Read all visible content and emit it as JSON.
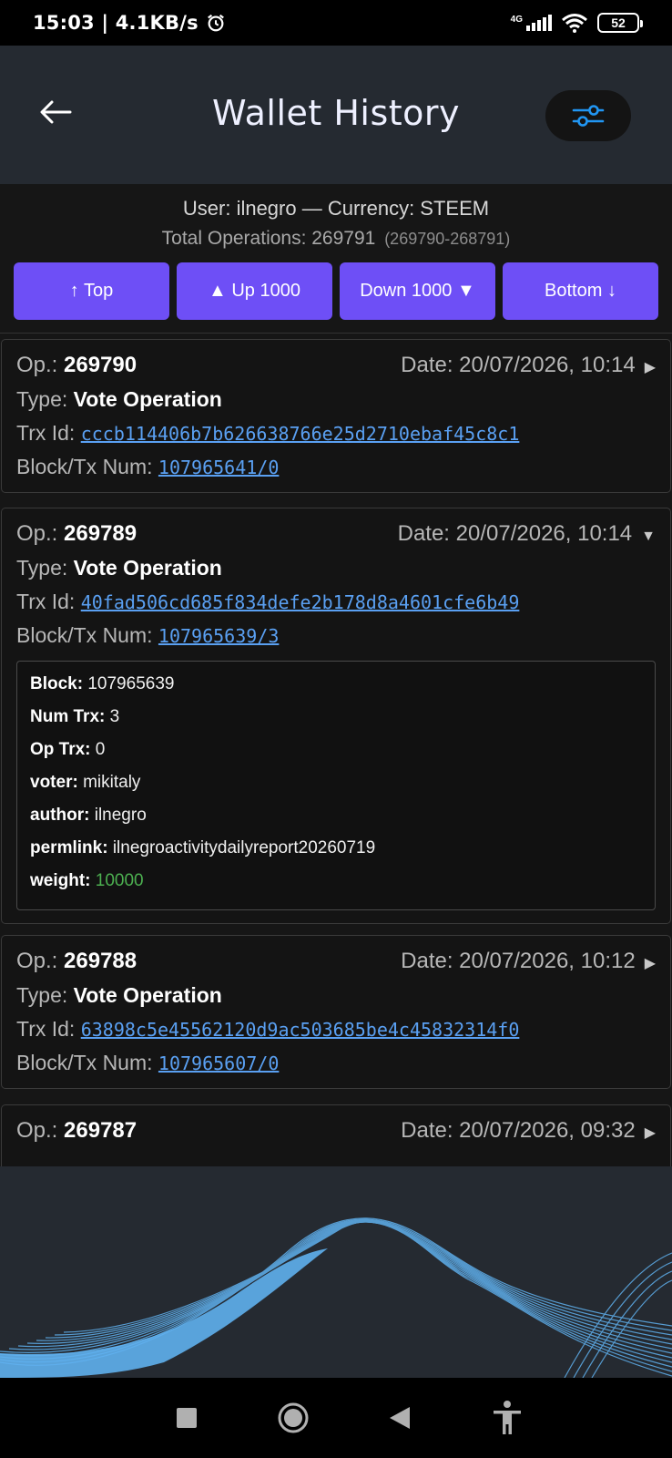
{
  "status": {
    "time": "15:03 | 4.1KB/s",
    "network": "4G",
    "battery": "52"
  },
  "header": {
    "title": "Wallet History"
  },
  "meta": {
    "user_line": "User: ilnegro — Currency: STEEM",
    "total_label": "Total Operations: 269791",
    "range": "(269790-268791)"
  },
  "nav": {
    "top": "↑ Top",
    "up": "▲ Up 1000",
    "down": "Down 1000 ▼",
    "bottom": "Bottom ↓"
  },
  "labels": {
    "op": "Op.: ",
    "type": "Type: ",
    "trx": "Trx Id: ",
    "block": "Block/Tx Num: "
  },
  "ops": [
    {
      "num": "269790",
      "date": "Date: 20/07/2026, 10:14",
      "caret": "▶",
      "type": "Vote Operation",
      "trx": "cccb114406b7b626638766e25d2710ebaf45c8c1",
      "block": "107965641/0"
    },
    {
      "num": "269789",
      "date": "Date: 20/07/2026, 10:14",
      "caret": "▼",
      "type": "Vote Operation",
      "trx": "40fad506cd685f834defe2b178d8a4601cfe6b49",
      "block": "107965639/3",
      "details": {
        "block_k": "Block:",
        "block_v": "107965639",
        "numtrx_k": "Num Trx:",
        "numtrx_v": "3",
        "optrx_k": "Op Trx:",
        "optrx_v": "0",
        "voter_k": "voter:",
        "voter_v": "mikitaly",
        "author_k": "author:",
        "author_v": "ilnegro",
        "permlink_k": "permlink:",
        "permlink_v": "ilnegroactivitydailyreport20260719",
        "weight_k": "weight:",
        "weight_v": "10000"
      }
    },
    {
      "num": "269788",
      "date": "Date: 20/07/2026, 10:12",
      "caret": "▶",
      "type": "Vote Operation",
      "trx": "63898c5e45562120d9ac503685be4c45832314f0",
      "block": "107965607/0"
    },
    {
      "num": "269787",
      "date": "Date: 20/07/2026, 09:32",
      "caret": "▶"
    }
  ],
  "colors": {
    "accent": "#6e4ff6",
    "link": "#5aa0f2",
    "header_bg": "#252a31",
    "filter_icon": "#2196f3",
    "positive": "#4caf50"
  },
  "icons": {
    "back": "arrow-left-icon",
    "filter": "sliders-icon",
    "alarm": "alarm-clock-icon",
    "signal": "signal-icon",
    "wifi": "wifi-icon",
    "recents": "square-icon",
    "home": "circle-icon",
    "nav_back": "triangle-back-icon",
    "accessibility": "accessibility-icon"
  }
}
